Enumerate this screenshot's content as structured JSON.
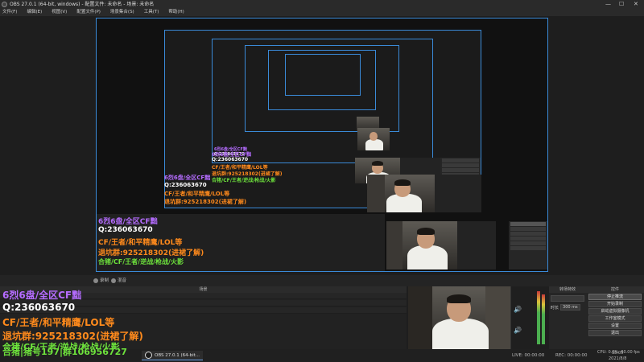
{
  "window": {
    "title": "OBS 27.0.1 (64-bit, windows) - 配置文件: 未命名 - 场景: 未命名",
    "minimize": "—",
    "maximize": "☐",
    "close": "✕"
  },
  "menu": {
    "items": [
      "文件(F)",
      "编辑(E)",
      "视图(V)",
      "配置文件(P)",
      "场景集合(S)",
      "工具(T)",
      "帮助(H)"
    ]
  },
  "overlay": {
    "line1": "6烈6盘/全区CF黜",
    "line2": "Q:236063670",
    "line3": "CF/王者/和平精鹰/LOL等",
    "line4": "退坑群:925218302(进裙了解)",
    "line5": "合猪/CF/王者/逆战/枪战/火影",
    "line6": "合猪|猪号197|群106956727"
  },
  "controls_bar": {
    "preview_label": "录制",
    "mixer_label": "混音"
  },
  "scenes": {
    "header": "场景",
    "row_label": "OBS 27.0.1 (64-bit..."
  },
  "audio": {
    "icon": "🔊"
  },
  "transition": {
    "header": "转场特效",
    "duration_label": "时长",
    "duration_value": "300 ms"
  },
  "controls": {
    "header": "控件",
    "buttons": [
      "停止推流",
      "开始录制",
      "启动虚拟摄像机",
      "工作室模式",
      "设置",
      "退出"
    ]
  },
  "status": {
    "live": "LIVE: 00:00:00",
    "rec": "REC: 00:00:00",
    "cpu": "CPU: 0.0%, 60.00 fps",
    "time": "18:05",
    "date": "2021/8/8"
  },
  "taskbar": {
    "obs_item": "OBS 27.0.1 (64-bit..."
  }
}
